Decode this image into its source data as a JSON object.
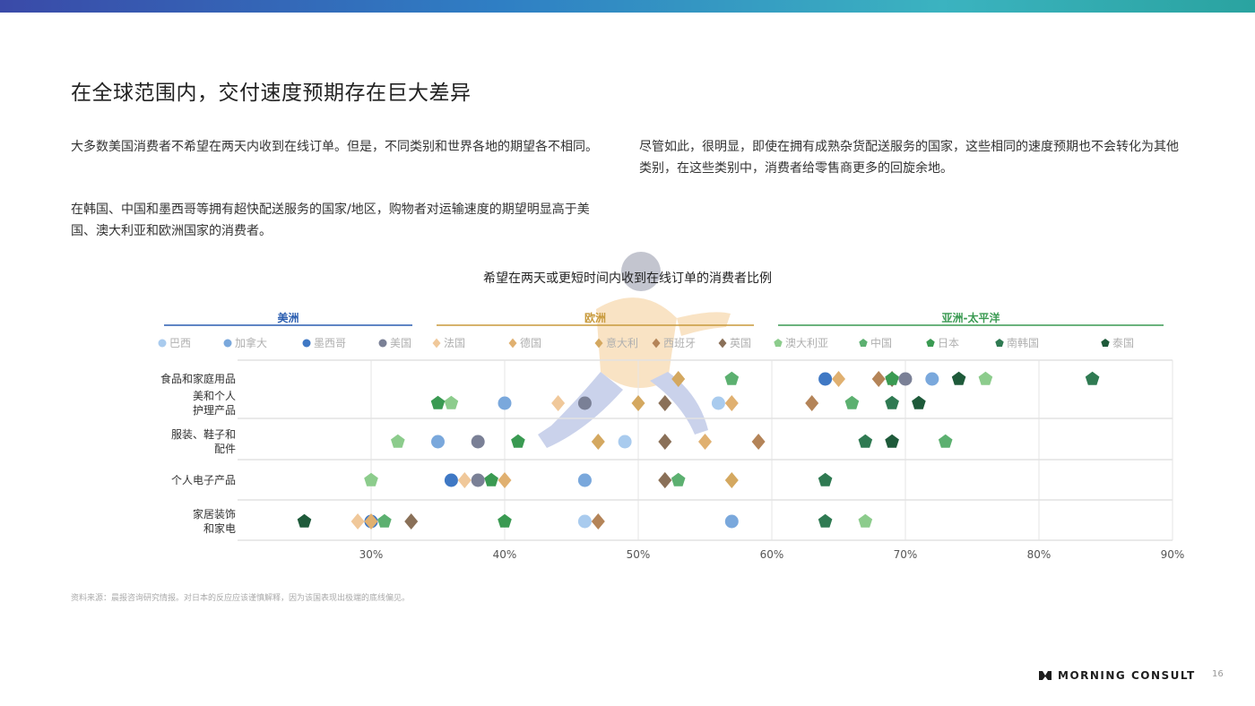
{
  "page": {
    "title": "在全球范围内，交付速度预期存在巨大差异",
    "paragraphs": [
      "大多数美国消费者不希望在两天内收到在线订单。但是，不同类别和世界各地的期望各不相同。",
      "在韩国、中国和墨西哥等拥有超快配送服务的国家/地区，购物者对运输速度的期望明显高于美国、澳大利亚和欧洲国家的消费者。",
      "尽管如此，很明显，即使在拥有成熟杂货配送服务的国家，这些相同的速度预期也不会转化为其他类别，在这些类别中，消费者给零售商更多的回旋余地。"
    ],
    "source": "资料来源：晨报咨询研究情报。对日本的反应应该谨慎解释，因为该国表现出极端的底线偏见。",
    "logo_text": "MORNING CONSULT",
    "page_number": "16"
  },
  "chart_data": {
    "type": "scatter",
    "title": "希望在两天或更短时间内收到在线订单的消费者比例",
    "xlim": [
      20,
      90
    ],
    "x_ticks": [
      30,
      40,
      50,
      60,
      70,
      80,
      90
    ],
    "x_tick_labels": [
      "30%",
      "40%",
      "50%",
      "60%",
      "70%",
      "80%",
      "90%"
    ],
    "categories": [
      "食品和家庭用品",
      "美和个人护理产品",
      "服装、鞋子和配件",
      "个人电子产品",
      "家居装饰和家电"
    ],
    "category_lines": [
      [
        "食品和家庭用品"
      ],
      [
        "美和个人",
        "护理产品"
      ],
      [
        "服装、鞋子和",
        "配件"
      ],
      [
        "个人电子产品"
      ],
      [
        "家居装饰",
        "和家电"
      ]
    ],
    "groups": [
      {
        "name": "美洲",
        "color": "#2a5db0"
      },
      {
        "name": "欧洲",
        "color": "#c89a3c"
      },
      {
        "name": "亚洲-太平洋",
        "color": "#3a9a52"
      }
    ],
    "series": [
      {
        "name": "巴西",
        "group": "美洲",
        "marker": "circle",
        "color": "#a9cbee",
        "values": [
          null,
          56,
          49,
          46,
          46
        ]
      },
      {
        "name": "加拿大",
        "group": "美洲",
        "marker": "circle",
        "color": "#7aa8dc",
        "values": [
          72,
          40,
          35,
          46,
          57
        ]
      },
      {
        "name": "墨西哥",
        "group": "美洲",
        "marker": "circle",
        "color": "#3f78c4",
        "values": [
          64,
          null,
          null,
          36,
          30
        ]
      },
      {
        "name": "美国",
        "group": "美洲",
        "marker": "circle",
        "color": "#7a8096",
        "values": [
          70,
          46,
          38,
          38,
          null
        ]
      },
      {
        "name": "法国",
        "group": "欧洲",
        "marker": "diamond",
        "color": "#f0c89a",
        "values": [
          null,
          44,
          null,
          37,
          29
        ]
      },
      {
        "name": "德国",
        "group": "欧洲",
        "marker": "diamond",
        "color": "#e0b070",
        "values": [
          65,
          57,
          55,
          40,
          30
        ]
      },
      {
        "name": "意大利",
        "group": "欧洲",
        "marker": "diamond",
        "color": "#d4a860",
        "values": [
          53,
          50,
          47,
          57,
          null
        ]
      },
      {
        "name": "西班牙",
        "group": "欧洲",
        "marker": "diamond",
        "color": "#b48458",
        "values": [
          68,
          63,
          59,
          52,
          47
        ]
      },
      {
        "name": "英国",
        "group": "欧洲",
        "marker": "diamond",
        "color": "#8a7058",
        "values": [
          69,
          52,
          52,
          52,
          33
        ]
      },
      {
        "name": "澳大利亚",
        "group": "亚洲-太平洋",
        "marker": "pentagon",
        "color": "#8ccc8c",
        "values": [
          76,
          36,
          32,
          30,
          67
        ]
      },
      {
        "name": "中国",
        "group": "亚洲-太平洋",
        "marker": "pentagon",
        "color": "#5cb070",
        "values": [
          57,
          66,
          73,
          53,
          31
        ]
      },
      {
        "name": "日本",
        "group": "亚洲-太平洋",
        "marker": "pentagon",
        "color": "#3a9a52",
        "values": [
          69,
          35,
          41,
          39,
          40
        ]
      },
      {
        "name": "南韩国",
        "group": "亚洲-太平洋",
        "marker": "pentagon",
        "color": "#2f7a52",
        "values": [
          84,
          69,
          67,
          64,
          64
        ]
      },
      {
        "name": "泰国",
        "group": "亚洲-太平洋",
        "marker": "pentagon",
        "color": "#1e5a3a",
        "values": [
          74,
          71,
          69,
          null,
          25
        ]
      }
    ]
  }
}
